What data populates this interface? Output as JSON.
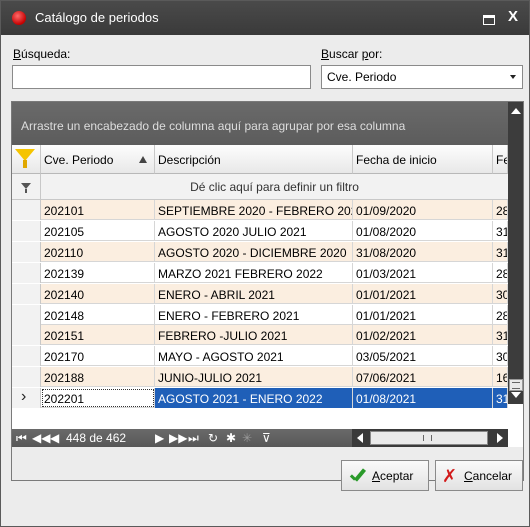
{
  "window": {
    "title": "Catálogo de periodos",
    "close_glyph": "X",
    "icon": "app-red-circle-icon"
  },
  "search": {
    "label_accel": "B",
    "label_rest": "úsqueda:",
    "value": "",
    "placeholder": ""
  },
  "search_by": {
    "label_accel": "B",
    "label_mid": "uscar ",
    "label_accel2": "p",
    "label_rest": "or:",
    "selected": "Cve. Periodo"
  },
  "grid": {
    "group_panel_text": "Arrastre un encabezado de columna aquí para agrupar por esa columna",
    "columns": [
      "Cve. Periodo",
      "Descripción",
      "Fecha de inicio",
      "Fe"
    ],
    "filter_row_text": "Dé clic aquí para definir un filtro",
    "rows": [
      [
        "202101",
        "SEPTIEMBRE 2020 - FEBRERO 2021",
        "01/09/2020",
        "28"
      ],
      [
        "202105",
        "AGOSTO 2020 JULIO 2021",
        "01/08/2020",
        "31"
      ],
      [
        "202110",
        "AGOSTO 2020 - DICIEMBRE 2020",
        "31/08/2020",
        "31"
      ],
      [
        "202139",
        "MARZO 2021 FEBRERO 2022",
        "01/03/2021",
        "28"
      ],
      [
        "202140",
        "ENERO - ABRIL 2021",
        "01/01/2021",
        "30"
      ],
      [
        "202148",
        "ENERO - FEBRERO 2021",
        "01/01/2021",
        "28"
      ],
      [
        "202151",
        "FEBRERO -JULIO 2021",
        "01/02/2021",
        "31"
      ],
      [
        "202170",
        "MAYO - AGOSTO 2021",
        "03/05/2021",
        "30"
      ],
      [
        "202188",
        "JUNIO-JULIO 2021",
        "07/06/2021",
        "16"
      ],
      [
        "202201",
        "AGOSTO 2021 - ENERO 2022",
        "01/08/2021",
        "31"
      ]
    ],
    "selected_row_index": 9,
    "navigator": {
      "position": "448 de 462"
    }
  },
  "buttons": {
    "accept_accel": "A",
    "accept_rest": "ceptar",
    "cancel_accel": "C",
    "cancel_rest": "ancelar"
  },
  "colors": {
    "title_bar": "#3f3f3f",
    "selection": "#1f5fb8",
    "row_alt": "#fbeee0",
    "filter_funnel": "#f5c400",
    "cancel_x": "#d21a1a",
    "accept_check": "#2a9a2a"
  }
}
